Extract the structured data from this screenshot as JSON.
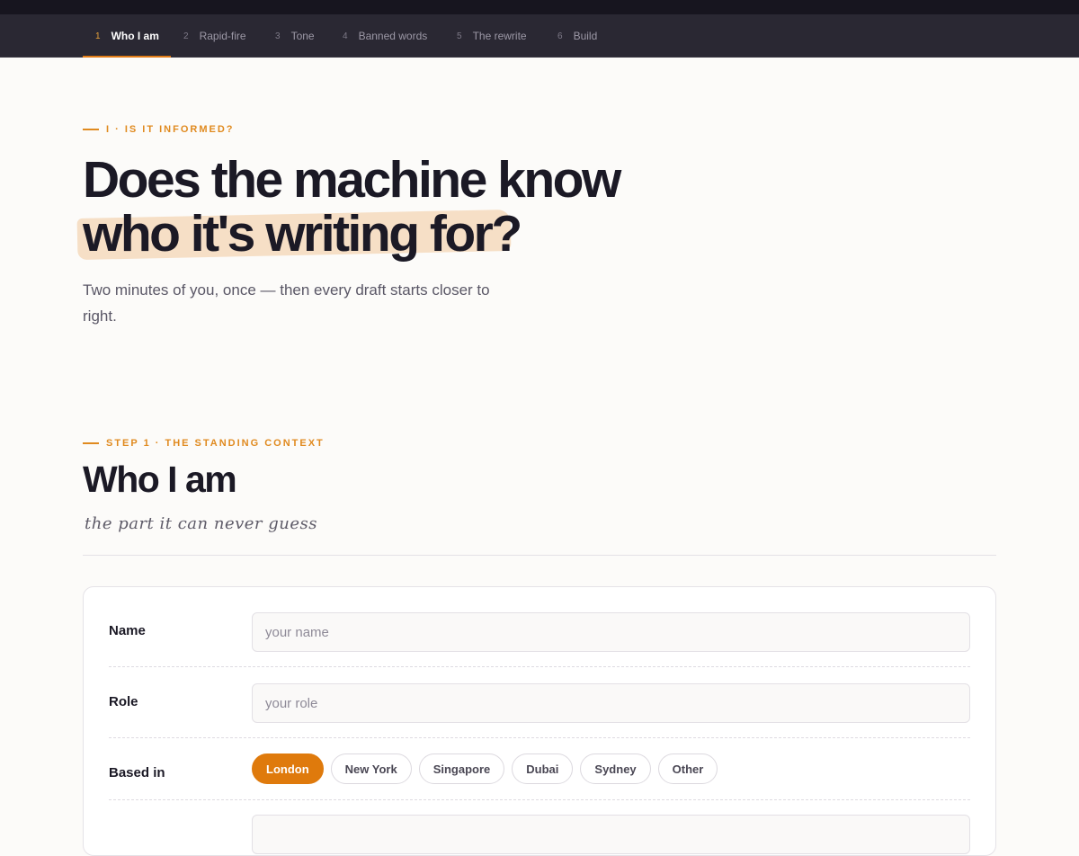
{
  "nav": {
    "items": [
      {
        "num": "1",
        "label": "Who I am"
      },
      {
        "num": "2",
        "label": "Rapid-fire"
      },
      {
        "num": "3",
        "label": "Tone"
      },
      {
        "num": "4",
        "label": "Banned words"
      },
      {
        "num": "5",
        "label": "The rewrite"
      },
      {
        "num": "6",
        "label": "Build"
      }
    ],
    "active": "Who I am"
  },
  "hero": {
    "eyebrow": "I · IS IT INFORMED?",
    "title_line1": "Does the machine know",
    "title_line2": "who it's writing for?",
    "subtitle": "Two minutes of you, once — then every draft starts closer to right."
  },
  "section": {
    "eyebrow": "STEP 1 · THE STANDING CONTEXT",
    "title": "Who I am",
    "handwritten": "the part it can never guess"
  },
  "form": {
    "name": {
      "label": "Name",
      "value": "",
      "placeholder": "your name"
    },
    "role": {
      "label": "Role",
      "value": "",
      "placeholder": "your role"
    },
    "based_in": {
      "label": "Based in",
      "options": [
        "London",
        "New York",
        "Singapore",
        "Dubai",
        "Sydney",
        "Other"
      ],
      "selected": "London"
    }
  },
  "colors": {
    "accent": "#df7a0c",
    "nav_bg": "#2a2833",
    "highlight": "#f5dcc0"
  }
}
